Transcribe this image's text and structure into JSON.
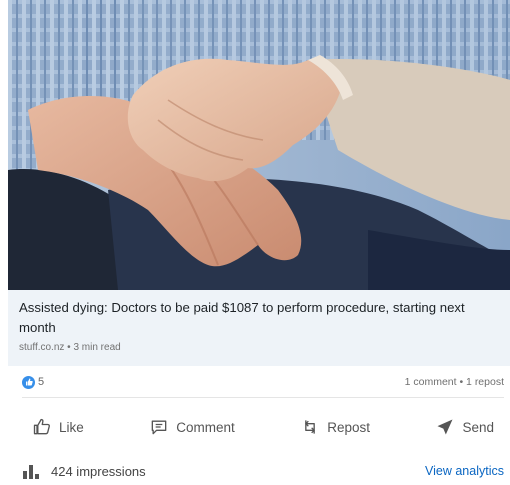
{
  "post": {
    "headline": "Assisted dying: Doctors to be paid $1087 to perform procedure, starting next month",
    "source": "stuff.co.nz • 3 min read",
    "image_alt": "hands-resting-on-knee"
  },
  "social": {
    "reaction_count": "5",
    "comments_reposts": "1 comment • 1 repost"
  },
  "actions": {
    "like": "Like",
    "comment": "Comment",
    "repost": "Repost",
    "send": "Send"
  },
  "footer": {
    "impressions": "424 impressions",
    "analytics_link": "View analytics"
  },
  "colors": {
    "link_blue": "#0a66c2",
    "like_badge_blue": "#378fe9",
    "card_background": "#eef3f8"
  }
}
